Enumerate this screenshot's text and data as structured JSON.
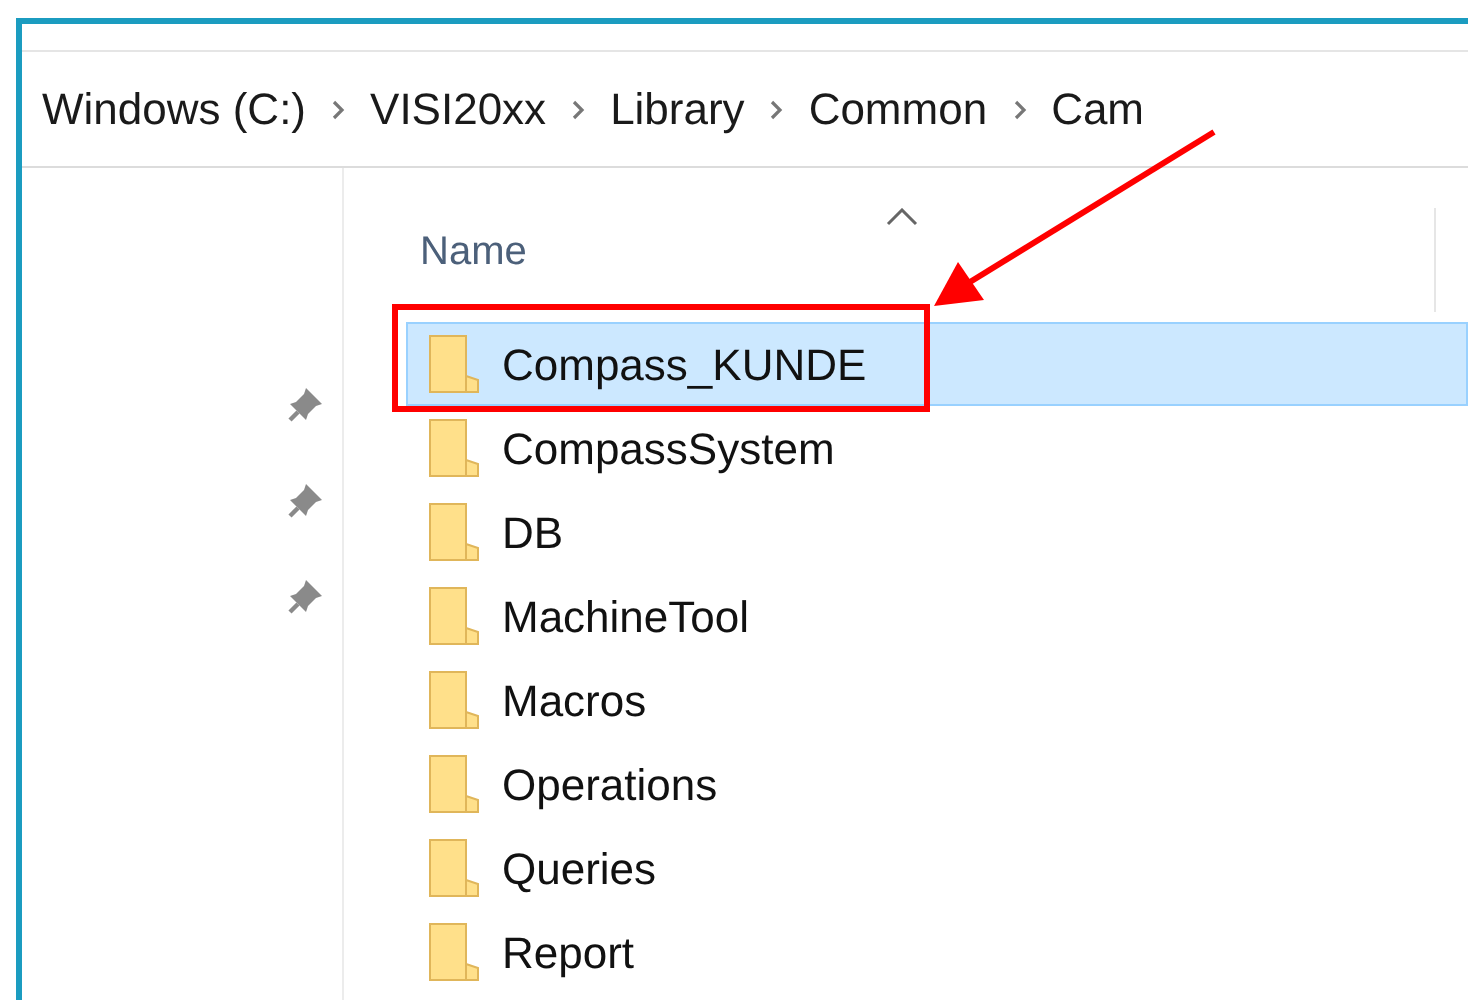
{
  "breadcrumb": [
    {
      "label": "Windows (C:)"
    },
    {
      "label": "VISI20xx"
    },
    {
      "label": "Library"
    },
    {
      "label": "Common"
    },
    {
      "label": "Cam"
    }
  ],
  "quick_access": {
    "pinned": [
      true,
      true,
      true
    ]
  },
  "file_list": {
    "columns": [
      {
        "label": "Name",
        "sorted": true
      }
    ],
    "rows": [
      {
        "name": "Compass_KUNDE",
        "selected": true,
        "highlighted": true
      },
      {
        "name": "CompassSystem",
        "selected": false,
        "highlighted": false
      },
      {
        "name": "DB",
        "selected": false,
        "highlighted": false
      },
      {
        "name": "MachineTool",
        "selected": false,
        "highlighted": false
      },
      {
        "name": "Macros",
        "selected": false,
        "highlighted": false
      },
      {
        "name": "Operations",
        "selected": false,
        "highlighted": false
      },
      {
        "name": "Queries",
        "selected": false,
        "highlighted": false
      },
      {
        "name": "Report",
        "selected": false,
        "highlighted": false
      }
    ]
  }
}
